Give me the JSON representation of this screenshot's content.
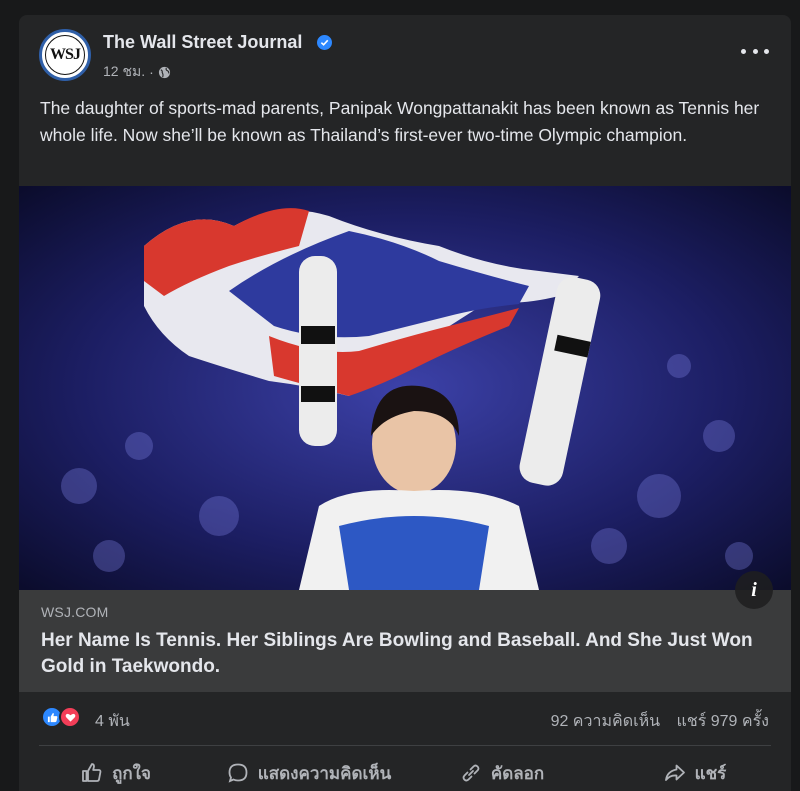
{
  "post": {
    "page_name": "The Wall Street Journal",
    "avatar_text": "WSJ",
    "time": "12 ชม.",
    "separator": "·",
    "text": "The daughter of sports-mad parents, Panipak Wongpattanakit has been known as Tennis her whole life. Now she’ll be known as Thailand’s first-ever two-time Olympic champion.",
    "verified_color": "#2d88ff"
  },
  "link": {
    "domain": "WSJ.COM",
    "title": "Her Name Is Tennis. Her Siblings Are Bowling and Baseball. And She Just Won Gold in Taekwondo.",
    "info_label": "i"
  },
  "reactions": {
    "count": "4 พัน",
    "comments": "92 ความคิดเห็น",
    "shares": "แชร์ 979 ครั้ง",
    "icons": [
      "like-icon",
      "love-icon"
    ]
  },
  "actions": {
    "like": "ถูกใจ",
    "comment": "แสดงความคิดเห็น",
    "copy": "คัดลอก",
    "share": "แชร์"
  }
}
